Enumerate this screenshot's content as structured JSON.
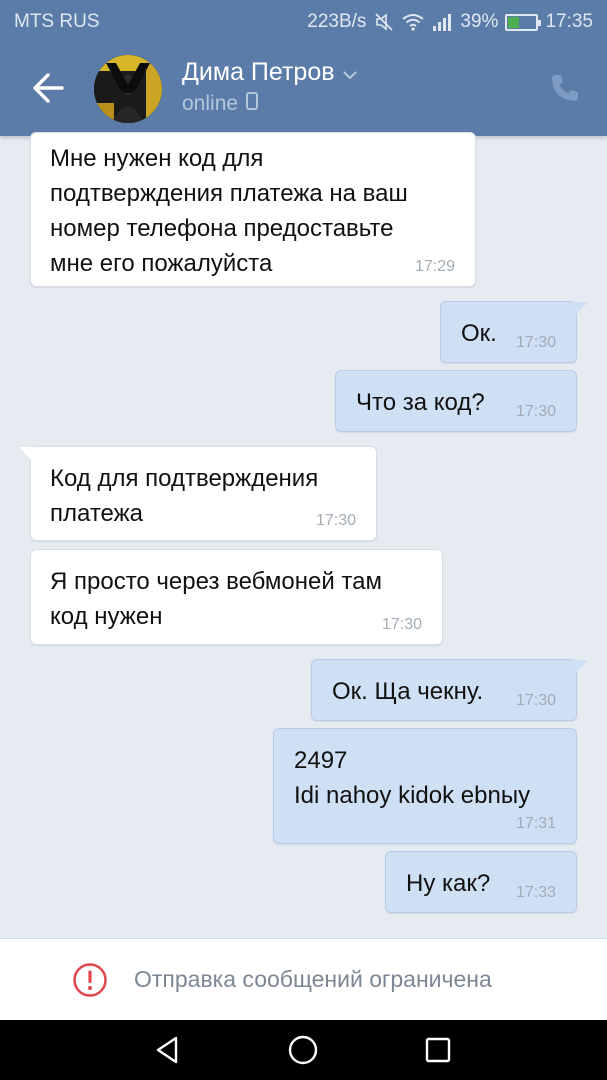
{
  "status_bar": {
    "carrier": "MTS RUS",
    "network_speed": "223B/s",
    "battery": "39%",
    "battery_level": 0.39,
    "time": "17:35",
    "icons": [
      "mute-icon",
      "wifi-icon",
      "signal-icon",
      "battery-charging-icon"
    ]
  },
  "header": {
    "contact_name": "Дима Петров",
    "status": "online",
    "icons": [
      "back-arrow-icon",
      "chevron-down-icon",
      "mobile-device-icon",
      "phone-call-icon"
    ]
  },
  "messages": [
    {
      "direction": "incoming",
      "text": "Мне нужен код для\nподтверждения платежа на ваш\nномер телефона предоставьте\nмне его пожалуйста",
      "time": "17:29"
    },
    {
      "direction": "outgoing",
      "text": "Ок.",
      "time": "17:30"
    },
    {
      "direction": "outgoing",
      "text": "Что за код?",
      "time": "17:30"
    },
    {
      "direction": "incoming",
      "text": "Код для подтверждения\nплатежа",
      "time": "17:30"
    },
    {
      "direction": "incoming",
      "text": "Я просто через вебмоней там\nкод нужен",
      "time": "17:30"
    },
    {
      "direction": "outgoing",
      "text": "Ок. Ща чекну.",
      "time": "17:30"
    },
    {
      "direction": "outgoing",
      "text": "2497\nIdi nahoy kidok ebnыy",
      "time": "17:31"
    },
    {
      "direction": "outgoing",
      "text": "Ну как?",
      "time": "17:33"
    }
  ],
  "composer": {
    "restriction_text": "Отправка сообщений ограничена",
    "icon": "warning-circle-icon"
  },
  "navigation": {
    "buttons": [
      "nav-back-icon",
      "nav-home-icon",
      "nav-recents-icon"
    ]
  },
  "colors": {
    "header": "#5b7ca8",
    "background": "#e6ebf2",
    "incoming_bubble": "#ffffff",
    "outgoing_bubble": "#cfe0f5",
    "warning": "#e0474c"
  }
}
